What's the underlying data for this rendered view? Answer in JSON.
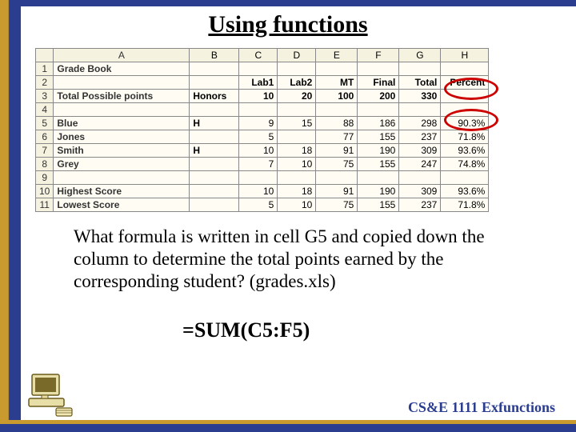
{
  "title": "Using functions",
  "chart_data": {
    "type": "table",
    "columns": [
      "",
      "A",
      "B",
      "C",
      "D",
      "E",
      "F",
      "G",
      "H"
    ],
    "rows": [
      {
        "num": "1",
        "A": "Grade Book",
        "B": "",
        "C": "",
        "D": "",
        "E": "",
        "F": "",
        "G": "",
        "H": ""
      },
      {
        "num": "2",
        "A": "",
        "B": "",
        "C": "Lab1",
        "D": "Lab2",
        "E": "MT",
        "F": "Final",
        "G": "Total",
        "H": "Percent"
      },
      {
        "num": "3",
        "A": "Total Possible points",
        "B": "Honors",
        "C": "10",
        "D": "20",
        "E": "100",
        "F": "200",
        "G": "330",
        "H": ""
      },
      {
        "num": "4",
        "A": "",
        "B": "",
        "C": "",
        "D": "",
        "E": "",
        "F": "",
        "G": "",
        "H": ""
      },
      {
        "num": "5",
        "A": "Blue",
        "B": "H",
        "C": "9",
        "D": "15",
        "E": "88",
        "F": "186",
        "G": "298",
        "H": "90.3%"
      },
      {
        "num": "6",
        "A": "Jones",
        "B": "",
        "C": "5",
        "D": "",
        "E": "77",
        "F": "155",
        "G": "237",
        "H": "71.8%"
      },
      {
        "num": "7",
        "A": "Smith",
        "B": "H",
        "C": "10",
        "D": "18",
        "E": "91",
        "F": "190",
        "G": "309",
        "H": "93.6%"
      },
      {
        "num": "8",
        "A": "Grey",
        "B": "",
        "C": "7",
        "D": "10",
        "E": "75",
        "F": "155",
        "G": "247",
        "H": "74.8%"
      },
      {
        "num": "9",
        "A": "",
        "B": "",
        "C": "",
        "D": "",
        "E": "",
        "F": "",
        "G": "",
        "H": ""
      },
      {
        "num": "10",
        "A": "Highest Score",
        "B": "",
        "C": "10",
        "D": "18",
        "E": "91",
        "F": "190",
        "G": "309",
        "H": "93.6%"
      },
      {
        "num": "11",
        "A": "Lowest Score",
        "B": "",
        "C": "5",
        "D": "10",
        "E": "75",
        "F": "155",
        "G": "237",
        "H": "71.8%"
      }
    ]
  },
  "question": "What formula is written in cell G5 and copied down the column to determine the total points earned by the corresponding student? (grades.xls)",
  "formula": "=SUM(C5:F5)",
  "footer": "CS&E 1111  Exfunctions"
}
